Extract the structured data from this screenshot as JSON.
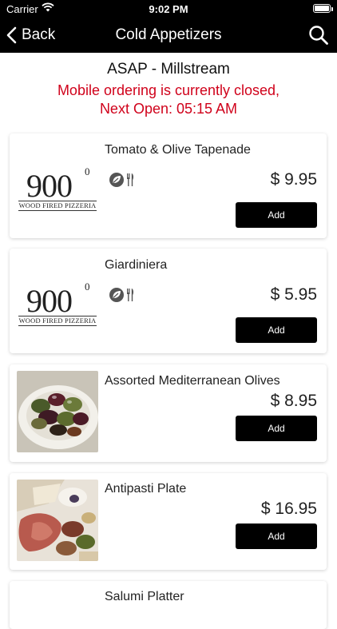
{
  "status_bar": {
    "carrier": "Carrier",
    "time": "9:02 PM"
  },
  "nav": {
    "back_label": "Back",
    "title": "Cold Appetizers",
    "icons": {
      "back": "chevron-left-icon",
      "search": "search-icon"
    }
  },
  "header": {
    "location": "ASAP - Millstream",
    "closed_message": "Mobile ordering is currently closed,",
    "next_open": "Next Open: 05:15 AM",
    "closed_color": "#d0021b"
  },
  "logo": {
    "number": "900",
    "degree": "0",
    "tagline": "WOOD FIRED PIZZERIA"
  },
  "items": [
    {
      "name": "Tomato & Olive Tapenade",
      "price": "$ 9.95",
      "add_label": "Add",
      "image": "logo",
      "tag_icons": [
        "vegan-leaf-icon",
        "utensils-icon"
      ]
    },
    {
      "name": "Giardiniera",
      "price": "$ 5.95",
      "add_label": "Add",
      "image": "logo",
      "tag_icons": [
        "vegan-leaf-icon",
        "utensils-icon"
      ]
    },
    {
      "name": "Assorted Mediterranean Olives",
      "price": "$ 8.95",
      "add_label": "Add",
      "image": "olives-photo"
    },
    {
      "name": "Antipasti Plate",
      "price": "$ 16.95",
      "add_label": "Add",
      "image": "antipasti-photo"
    },
    {
      "name": "Salumi Platter"
    }
  ],
  "colors": {
    "bar_background": "#000000",
    "button_background": "#000000",
    "button_text": "#ffffff"
  }
}
